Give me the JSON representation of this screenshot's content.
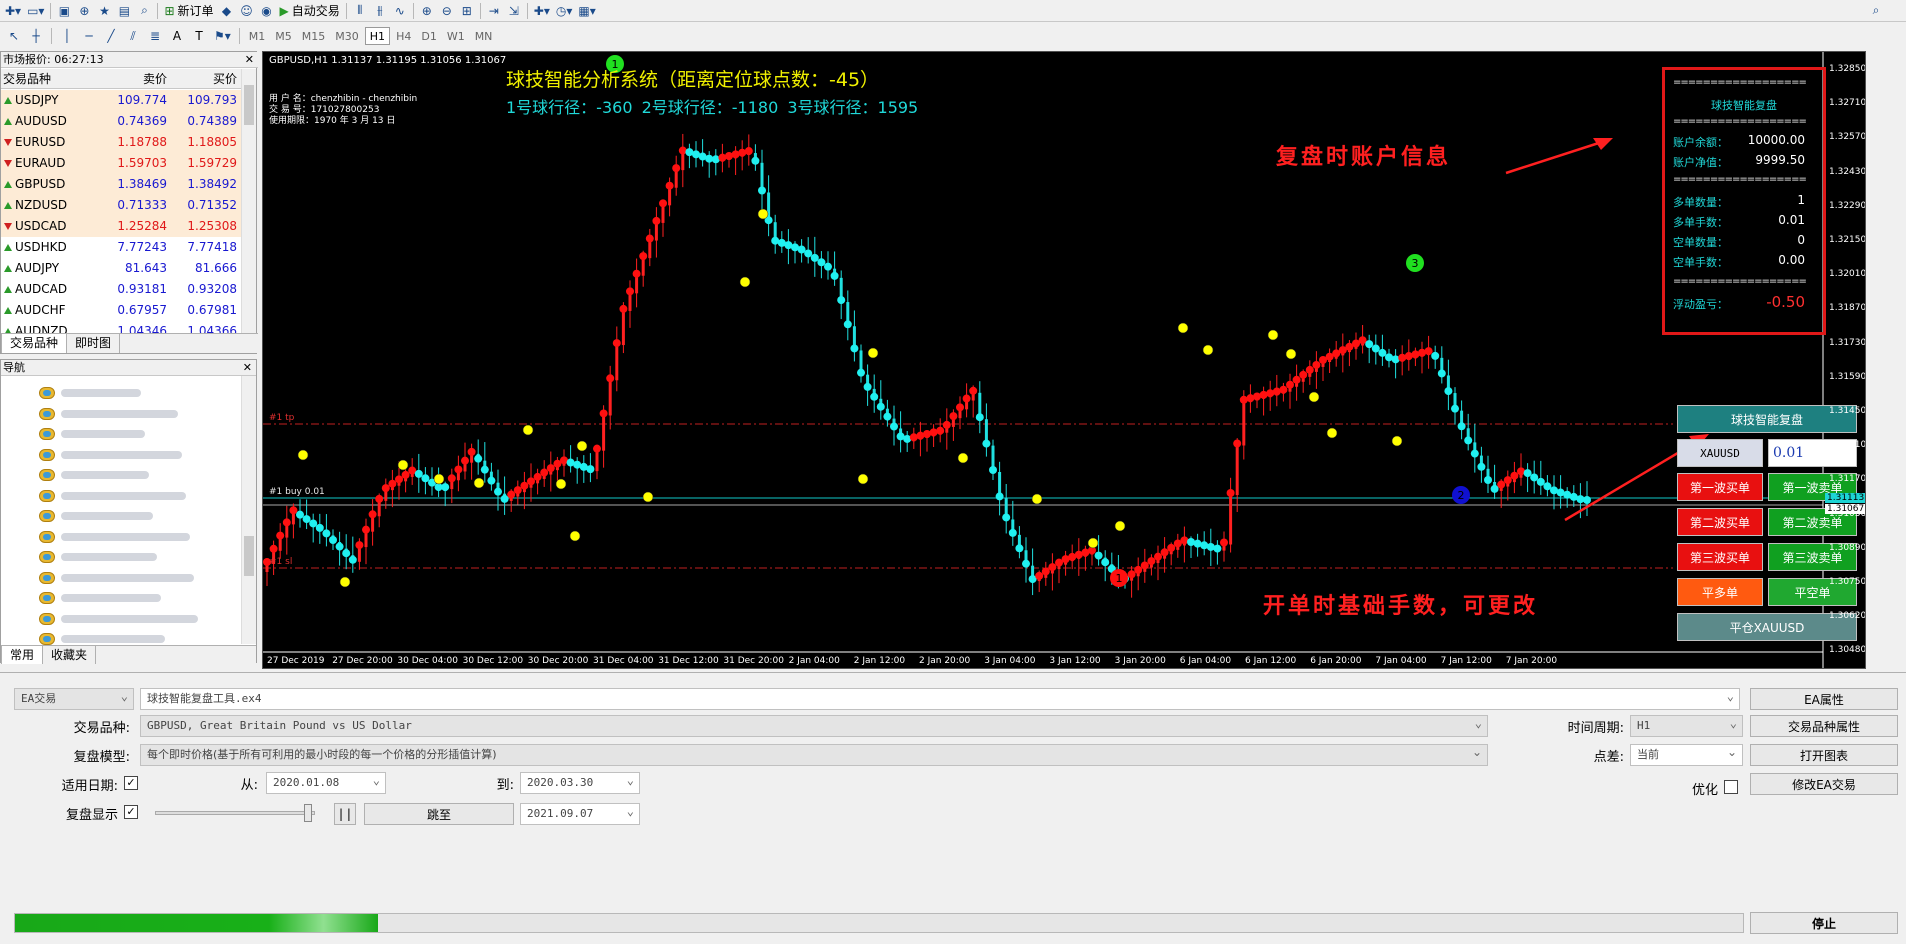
{
  "toolbar": {
    "new_order": "新订单",
    "auto_trade": "自动交易",
    "timeframes": [
      "M1",
      "M5",
      "M15",
      "M30",
      "H1",
      "H4",
      "D1",
      "W1",
      "MN"
    ],
    "active_timeframe": "H1"
  },
  "market_watch": {
    "title": "市场报价: 06:27:13",
    "col_symbol": "交易品种",
    "col_bid": "卖价",
    "col_ask": "买价",
    "rows": [
      {
        "symbol": "USDJPY",
        "bid": "109.774",
        "ask": "109.793",
        "dir": "up"
      },
      {
        "symbol": "AUDUSD",
        "bid": "0.74369",
        "ask": "0.74389",
        "dir": "up"
      },
      {
        "symbol": "EURUSD",
        "bid": "1.18788",
        "ask": "1.18805",
        "dir": "dn"
      },
      {
        "symbol": "EURAUD",
        "bid": "1.59703",
        "ask": "1.59729",
        "dir": "dn"
      },
      {
        "symbol": "GBPUSD",
        "bid": "1.38469",
        "ask": "1.38492",
        "dir": "up"
      },
      {
        "symbol": "NZDUSD",
        "bid": "0.71333",
        "ask": "0.71352",
        "dir": "up"
      },
      {
        "symbol": "USDCAD",
        "bid": "1.25284",
        "ask": "1.25308",
        "dir": "dn"
      },
      {
        "symbol": "USDHKD",
        "bid": "7.77243",
        "ask": "7.77418",
        "dir": "up"
      },
      {
        "symbol": "AUDJPY",
        "bid": "81.643",
        "ask": "81.666",
        "dir": "up"
      },
      {
        "symbol": "AUDCAD",
        "bid": "0.93181",
        "ask": "0.93208",
        "dir": "up"
      },
      {
        "symbol": "AUDCHF",
        "bid": "0.67957",
        "ask": "0.67981",
        "dir": "up"
      },
      {
        "symbol": "AUDNZD",
        "bid": "1.04346",
        "ask": "1.04366",
        "dir": "up"
      }
    ],
    "tabs": [
      "交易品种",
      "即时图"
    ]
  },
  "navigator": {
    "title": "导航",
    "tabs": [
      "常用",
      "收藏夹"
    ]
  },
  "chart": {
    "title": "GBPUSD,H1  1.31137 1.31195 1.31056 1.31067",
    "user_lines": [
      "用 户 名：chenzhibin - chenzhibin",
      "交 易 号：171027800253",
      "使用期限：1970 年 3 月 13 日"
    ],
    "system_title": "球技智能分析系统（距离定位球点数：-45）",
    "ball_paths": "1号球行径：-360    2号球行径：-1180    3号球行径：1595",
    "annotation_account": "复盘时账户信息",
    "annotation_lot": "开单时基础手数，可更改",
    "level_tp": "#1 tp",
    "level_buy": "#1 buy 0.01",
    "level_sl": "#1 sl",
    "marker_labels": [
      "1",
      "2",
      "3"
    ],
    "price_axis": [
      "1.32850",
      "1.32710",
      "1.32570",
      "1.32430",
      "1.32290",
      "1.32150",
      "1.32010",
      "1.31870",
      "1.31730",
      "1.31590",
      "1.31450",
      "1.31310",
      "1.31170",
      "1.31030",
      "1.30890",
      "1.30750",
      "1.30620",
      "1.30480"
    ],
    "price_tag_bid": "1.31113",
    "price_tag_last": "1.31067",
    "time_axis": [
      "27 Dec 2019",
      "27 Dec 20:00",
      "30 Dec 04:00",
      "30 Dec 12:00",
      "30 Dec 20:00",
      "31 Dec 04:00",
      "31 Dec 12:00",
      "31 Dec 20:00",
      "2 Jan 04:00",
      "2 Jan 12:00",
      "2 Jan 20:00",
      "3 Jan 04:00",
      "3 Jan 12:00",
      "3 Jan 20:00",
      "6 Jan 04:00",
      "6 Jan 12:00",
      "6 Jan 20:00",
      "7 Jan 04:00",
      "7 Jan 12:00",
      "7 Jan 20:00"
    ]
  },
  "panel": {
    "sep": "==================",
    "title": "球技智能复盘",
    "balance_label": "账户余额：",
    "balance": "10000.00",
    "equity_label": "账户净值：",
    "equity": "9999.50",
    "long_count_label": "多单数量：",
    "long_count": "1",
    "long_lots_label": "多单手数：",
    "long_lots": "0.01",
    "short_count_label": "空单数量：",
    "short_count": "0",
    "short_lots_label": "空单手数：",
    "short_lots": "0.00",
    "float_label": "浮动盈亏：",
    "float": "-0.50"
  },
  "controls": {
    "replay": "球技智能复盘",
    "symbol": "XAUUSD",
    "lot": "0.01",
    "buy1": "第一波买单",
    "sell1": "第一波卖单",
    "buy2": "第二波买单",
    "sell2": "第二波卖单",
    "buy3": "第三波买单",
    "sell3": "第三波卖单",
    "close_long": "平多单",
    "close_short": "平空单",
    "close_all": "平仓XAUUSD",
    "colors": {
      "teal": "#1e8080",
      "red": "#e81010",
      "green": "#10a020",
      "orange": "#ff5a10",
      "grey": "#5c8a8a"
    }
  },
  "tester": {
    "mode": "EA交易",
    "ea": "球技智能复盘工具.ex4",
    "symbol_label": "交易品种:",
    "symbol": "GBPUSD, Great Britain Pound vs US Dollar",
    "model_label": "复盘模型:",
    "model": "每个即时价格(基于所有可利用的最小时段的每一个价格的分形插值计算)",
    "date_label": "适用日期:",
    "from_label": "从:",
    "from": "2020.01.08",
    "to_label": "到:",
    "to": "2020.03.30",
    "visual_label": "复盘显示",
    "jump": "跳至",
    "jump_date": "2021.09.07",
    "pause": "| |",
    "period_label": "时间周期:",
    "period": "H1",
    "spread_label": "点差:",
    "spread": "当前",
    "optimize_label": "优化",
    "btn_ea_props": "EA属性",
    "btn_symbol_props": "交易品种属性",
    "btn_open_chart": "打开图表",
    "btn_modify_ea": "修改EA交易",
    "btn_stop": "停止",
    "progress": 0.21
  }
}
